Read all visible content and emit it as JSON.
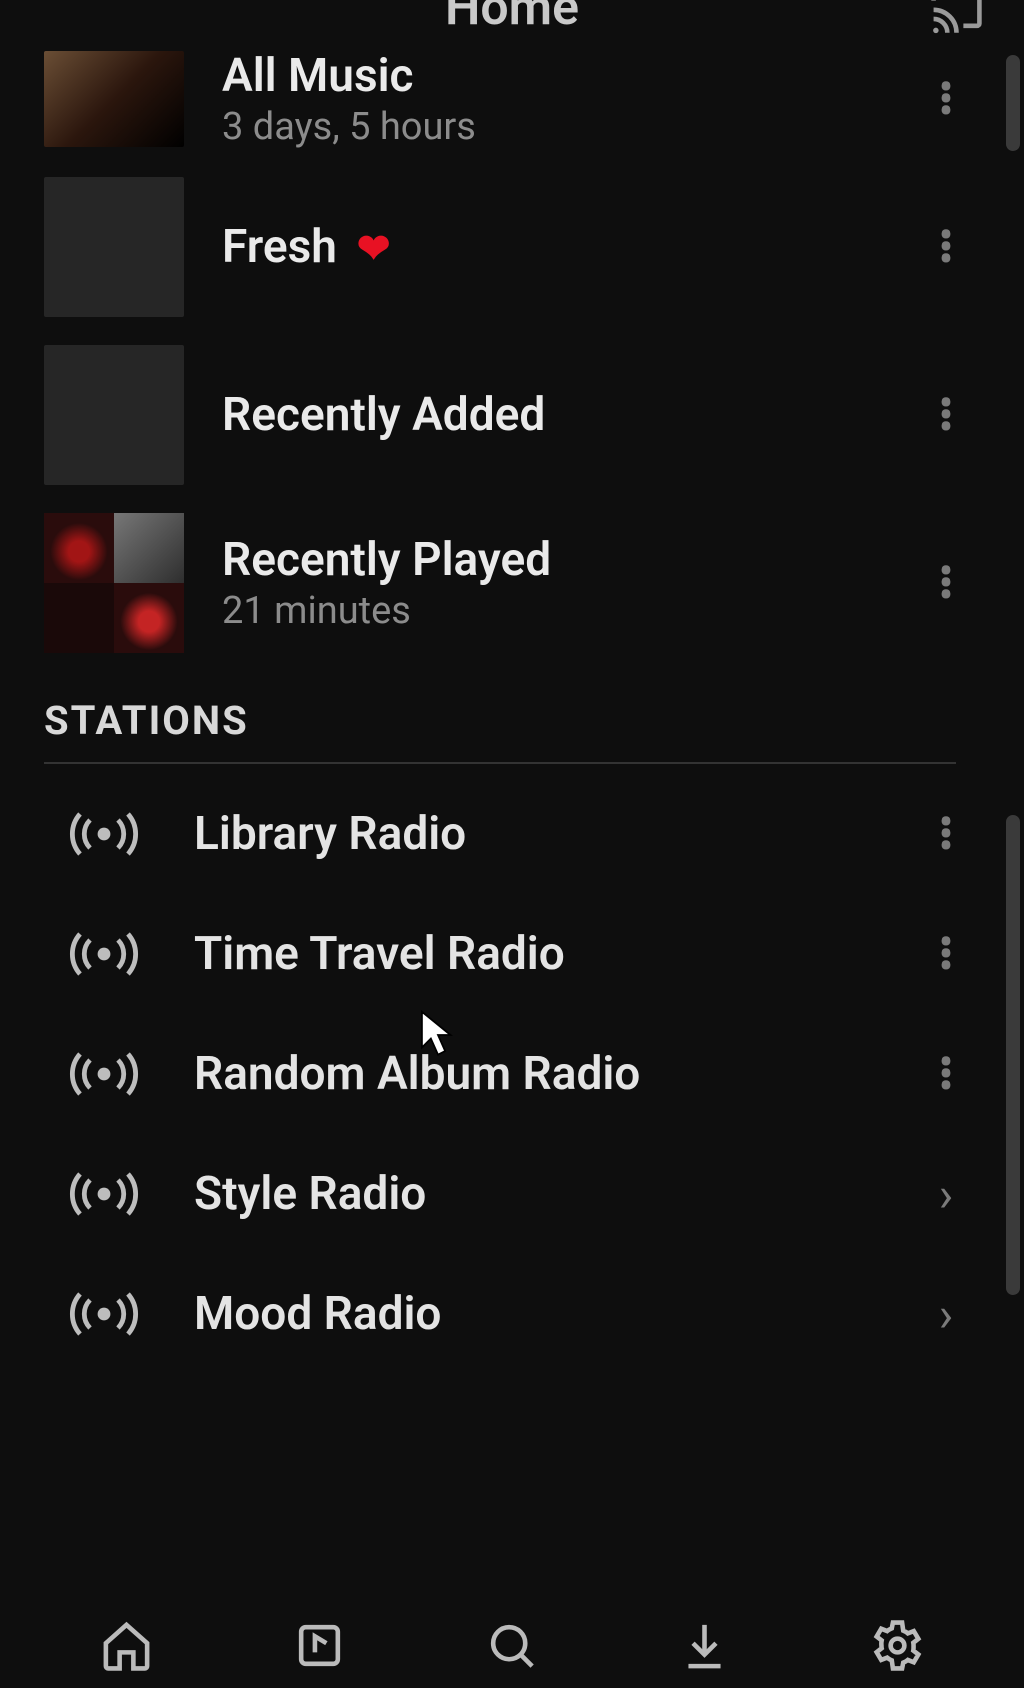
{
  "header": {
    "title": "Home"
  },
  "playlists": [
    {
      "title": "All Music",
      "subtitle": "3 days, 5 hours",
      "has_art": true,
      "heart": false
    },
    {
      "title": "Fresh",
      "subtitle": "",
      "has_art": false,
      "heart": true
    },
    {
      "title": "Recently Added",
      "subtitle": "",
      "has_art": false,
      "heart": false
    },
    {
      "title": "Recently Played",
      "subtitle": "21 minutes",
      "has_art": "quad",
      "heart": false
    }
  ],
  "section": {
    "stations_label": "STATIONS"
  },
  "stations": [
    {
      "title": "Library Radio",
      "trailing": "dots"
    },
    {
      "title": "Time Travel Radio",
      "trailing": "dots"
    },
    {
      "title": "Random Album Radio",
      "trailing": "dots"
    },
    {
      "title": "Style Radio",
      "trailing": "chevron"
    },
    {
      "title": "Mood Radio",
      "trailing": "chevron"
    }
  ],
  "colors": {
    "heart": "#e81123",
    "bg": "#0e0e0e"
  }
}
